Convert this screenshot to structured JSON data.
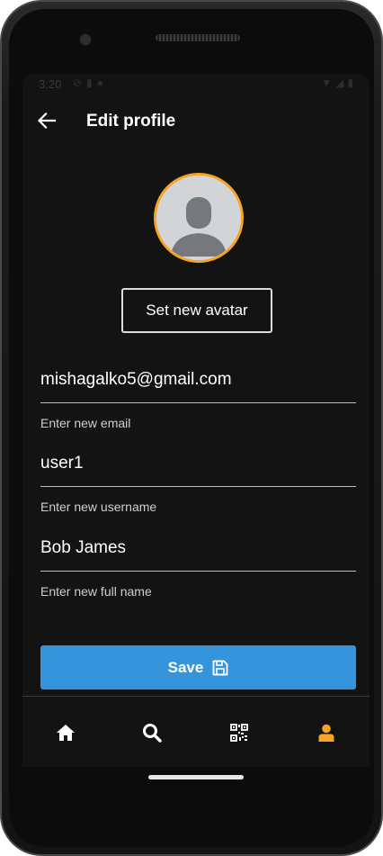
{
  "status_bar": {
    "time": "3:20",
    "left_icons": [
      "dnd-icon",
      "sim-icon",
      "sync-icon"
    ],
    "right_icons": [
      "wifi-icon",
      "signal-icon",
      "battery-icon"
    ]
  },
  "header": {
    "title": "Edit profile",
    "back_icon": "arrow-left-icon"
  },
  "avatar": {
    "placeholder_icon": "person-icon",
    "border_color": "#f5a523"
  },
  "avatar_button": {
    "label": "Set new avatar"
  },
  "form": {
    "email": {
      "value": "mishagalko5@gmail.com",
      "helper": "Enter new email"
    },
    "username": {
      "value": "user1",
      "helper": "Enter new username"
    },
    "full_name": {
      "value": "Bob James",
      "helper": "Enter new full name"
    }
  },
  "save_button": {
    "label": "Save",
    "icon": "floppy-disk-icon",
    "color": "#3595dc"
  },
  "bottom_nav": {
    "items": [
      {
        "name": "home",
        "icon": "home-icon",
        "active": false
      },
      {
        "name": "search",
        "icon": "search-icon",
        "active": false
      },
      {
        "name": "qr",
        "icon": "qr-code-icon",
        "active": false
      },
      {
        "name": "profile",
        "icon": "person-icon",
        "active": true
      }
    ],
    "active_color": "#f5a523",
    "inactive_color": "#ffffff"
  },
  "theme": {
    "background": "#131313",
    "text": "#ffffff",
    "accent": "#f5a523"
  }
}
